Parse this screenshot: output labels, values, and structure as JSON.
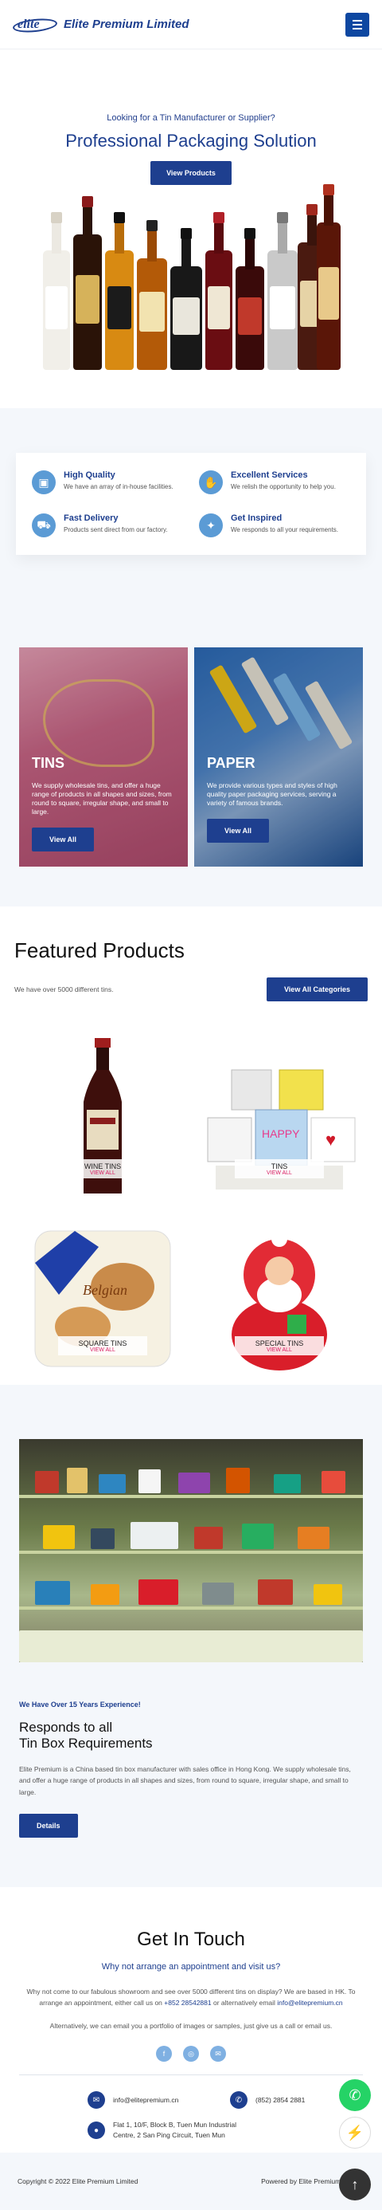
{
  "header": {
    "logo_word": "elite",
    "logo_text": "Elite Premium Limited"
  },
  "hero": {
    "subtitle": "Looking for a Tin Manufacturer or Supplier?",
    "title": "Professional Packaging Solution",
    "button": "View Products"
  },
  "features": [
    {
      "icon": "box-icon",
      "glyph": "▣",
      "title": "High Quality",
      "desc": "We have an array of in-house facilities."
    },
    {
      "icon": "handshake-icon",
      "glyph": "✋",
      "title": "Excellent Services",
      "desc": "We relish the opportunity to help you."
    },
    {
      "icon": "truck-icon",
      "glyph": "⛟",
      "title": "Fast Delivery",
      "desc": "Products sent direct from our factory."
    },
    {
      "icon": "lightbulb-icon",
      "glyph": "✦",
      "title": "Get Inspired",
      "desc": "We responds to all your requirements."
    }
  ],
  "categories": [
    {
      "title": "TINS",
      "desc": "We supply wholesale tins, and offer a huge range of products in all shapes and sizes, from round to square, irregular shape, and small to large.",
      "button": "View All"
    },
    {
      "title": "PAPER",
      "desc": "We provide various types and styles of high quality paper packaging services, serving a variety of famous brands.",
      "button": "View All"
    }
  ],
  "featured": {
    "title": "Featured Products",
    "subtitle": "We have over 5000 different tins.",
    "button": "View All Categories",
    "products": [
      {
        "name": "WINE TINS",
        "link": "VIEW ALL"
      },
      {
        "name": "TINS",
        "link": "VIEW ALL"
      },
      {
        "name": "SQUARE TINS",
        "link": "VIEW ALL"
      },
      {
        "name": "SPECIAL TINS",
        "link": "VIEW ALL"
      }
    ]
  },
  "story": {
    "kicker": "We Have Over 15 Years Experience!",
    "title_line1": "Responds to all",
    "title_line2": "Tin Box Requirements",
    "body": "Elite Premium is a China based tin box manufacturer with sales office in Hong Kong. We supply wholesale tins, and offer a huge range of products in all shapes and sizes, from round to square, irregular shape, and small to large.",
    "button": "Details"
  },
  "contact": {
    "title": "Get In Touch",
    "question": "Why not arrange an appointment and visit us?",
    "para1_a": "Why not come to our fabulous showroom and see over 5000 different tins on display? We are based in HK. To arrange an appointment, either call us on ",
    "para1_phone": "+852 28542881",
    "para1_b": " or alternatively email ",
    "para1_email": "info@elitepremium.cn",
    "para2": "Alternatively, we can email you a portfolio of images or samples, just give us a call or email us.",
    "email": "info@elitepremium.cn",
    "phone": "(852) 2854 2881",
    "address": "Flat 1, 10/F, Block B, Tuen Mun Industrial Centre, 2 San Ping Circuit, Tuen Mun"
  },
  "footer": {
    "copyright": "Copyright © 2022 Elite Premium Limited",
    "powered": "Powered by Elite Premium Limited"
  }
}
